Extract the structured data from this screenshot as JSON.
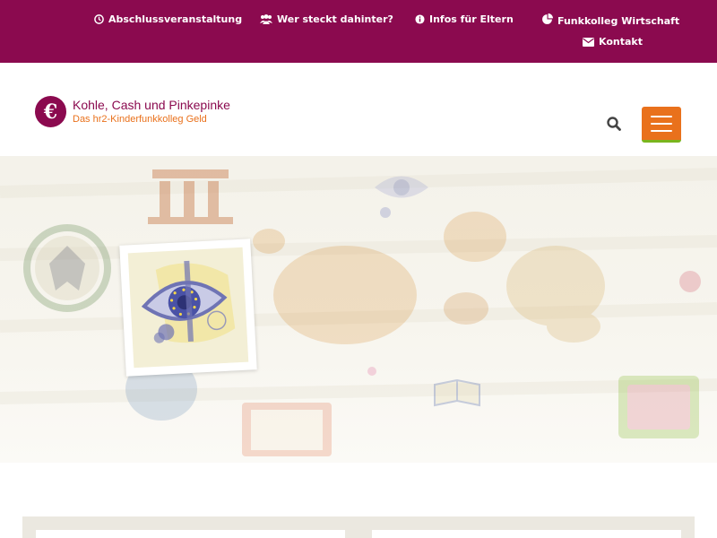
{
  "topnav": {
    "items": [
      {
        "label": "Abschlussveranstaltung",
        "icon": "clock-icon"
      },
      {
        "label": "Wer steckt dahinter?",
        "icon": "users-icon"
      },
      {
        "label": "Infos für Eltern",
        "icon": "info-circle-icon"
      },
      {
        "label": "Funkkolleg Wirtschaft",
        "icon": "pie-chart-icon"
      },
      {
        "label": "Kontakt",
        "icon": "envelope-icon"
      }
    ]
  },
  "logo": {
    "symbol": "€",
    "title": "Kohle, Cash und Pinkepinke",
    "subtitle": "Das hr2-Kinderfunkkolleg Geld"
  },
  "header": {
    "search_icon": "search-icon",
    "menu_icon": "hamburger-menu-icon"
  },
  "colors": {
    "brand": "#8b0a4f",
    "accent": "#e9711c",
    "accent_underline": "#7ab51d",
    "band": "#ebe8e0"
  }
}
